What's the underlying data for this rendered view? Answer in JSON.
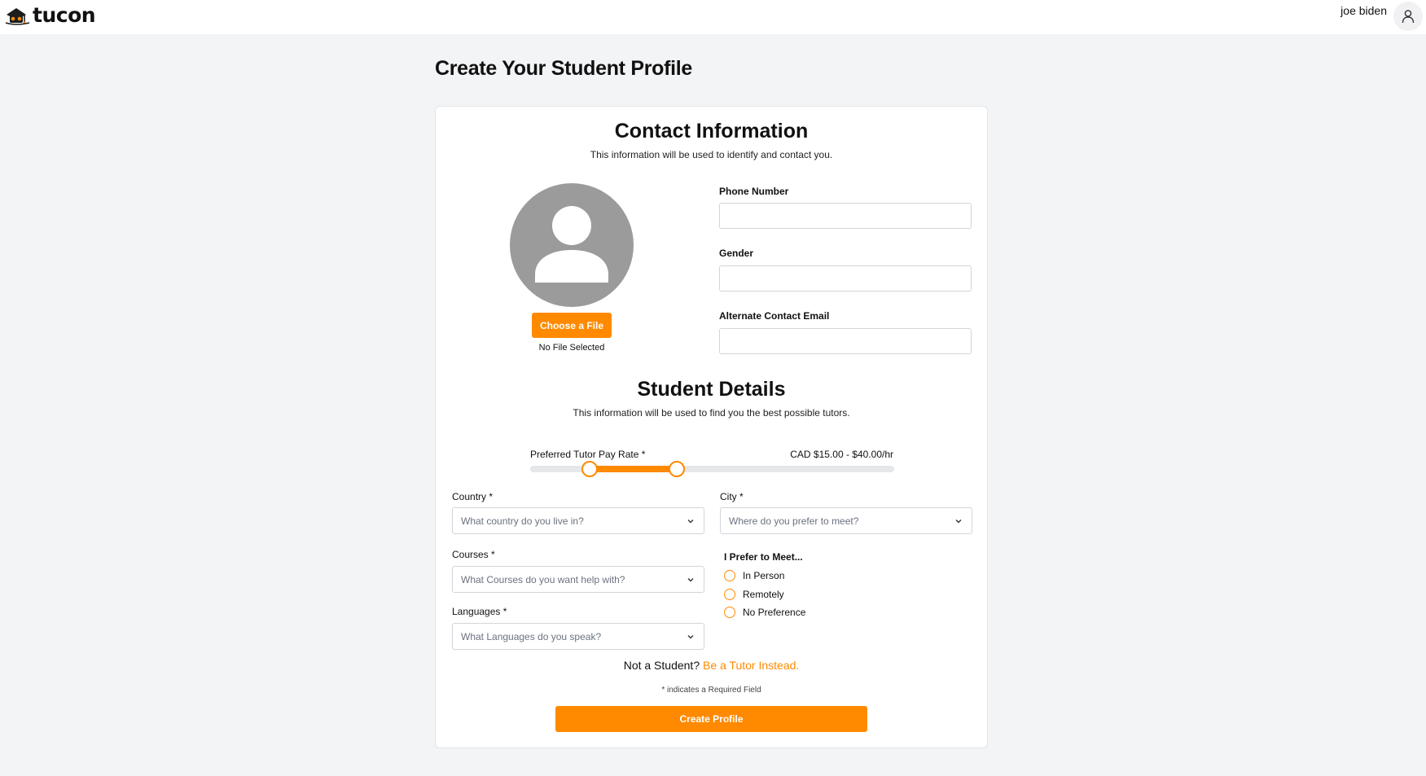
{
  "header": {
    "brand": "tucon",
    "user_name": "joe biden"
  },
  "page": {
    "title": "Create Your Student Profile"
  },
  "contact": {
    "heading": "Contact Information",
    "subheading": "This information will be used to identify and contact you.",
    "choose_file_label": "Choose a File",
    "file_status": "No File Selected",
    "phone_label": "Phone Number",
    "phone_value": "",
    "gender_label": "Gender",
    "gender_value": "",
    "alt_email_label": "Alternate Contact Email",
    "alt_email_value": ""
  },
  "details": {
    "heading": "Student Details",
    "subheading": "This information will be used to find you the best possible tutors.",
    "pay_rate": {
      "label": "Preferred Tutor Pay Rate *",
      "value_text": "CAD $15.00 - $40.00/hr",
      "range_start_fraction": 0.163,
      "range_end_fraction": 0.403
    },
    "country": {
      "label": "Country *",
      "placeholder": "What country do you live in?"
    },
    "city": {
      "label": "City *",
      "placeholder": "Where do you prefer to meet?"
    },
    "courses": {
      "label": "Courses *",
      "placeholder": "What Courses do you want help with?"
    },
    "languages": {
      "label": "Languages *",
      "placeholder": "What Languages do you speak?"
    },
    "meet": {
      "title": "I Prefer to Meet...",
      "options": [
        "In Person",
        "Remotely",
        "No Preference"
      ]
    }
  },
  "footer": {
    "switch_prefix": "Not a Student?",
    "switch_link": "Be a Tutor Instead.",
    "required_note": "* indicates a Required Field",
    "submit_label": "Create Profile"
  },
  "colors": {
    "accent": "#ff8a00",
    "page_bg": "#f3f4f6",
    "avatar_placeholder": "#9b9b9b"
  },
  "icons": [
    "logo-mark-icon",
    "user-icon",
    "person-placeholder-icon",
    "chevron-down-icon"
  ]
}
